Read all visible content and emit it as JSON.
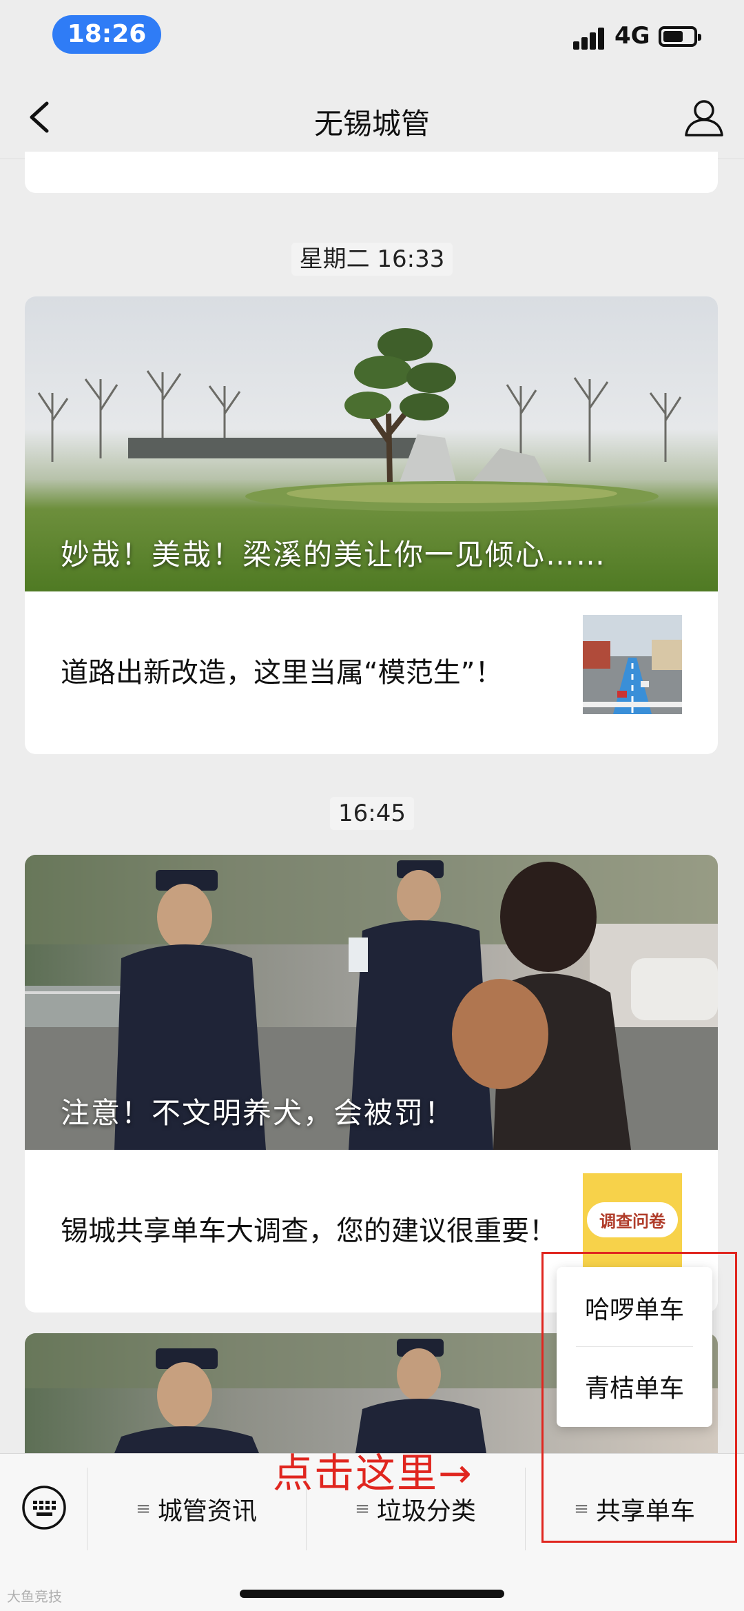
{
  "status_bar": {
    "time": "18:26",
    "network": "4G"
  },
  "nav": {
    "title": "无锡城管"
  },
  "feed": {
    "timestamp1": "星期二 16:33",
    "article1": {
      "hero_title": "妙哉！美哉！梁溪的美让你一见倾心……",
      "sub_title": "道路出新改造，这里当属“模范生”！"
    },
    "timestamp2": "16:45",
    "article2": {
      "hero_title": "注意！不文明养犬，会被罚！",
      "sub_title": "锡城共享单车大调查，您的建议很重要！",
      "thumb_text": "调查问卷"
    }
  },
  "bottom_menu": {
    "items": [
      {
        "label": "城管资讯"
      },
      {
        "label": "垃圾分类"
      },
      {
        "label": "共享单车"
      }
    ],
    "submenu": [
      {
        "label": "哈啰单车"
      },
      {
        "label": "青桔单车"
      }
    ]
  },
  "annotation": {
    "text": "点击这里→",
    "color": "#e0261f"
  },
  "watermark": "大鱼竞技",
  "colors": {
    "time_pill": "#2f7cf6",
    "background": "#ededed"
  }
}
